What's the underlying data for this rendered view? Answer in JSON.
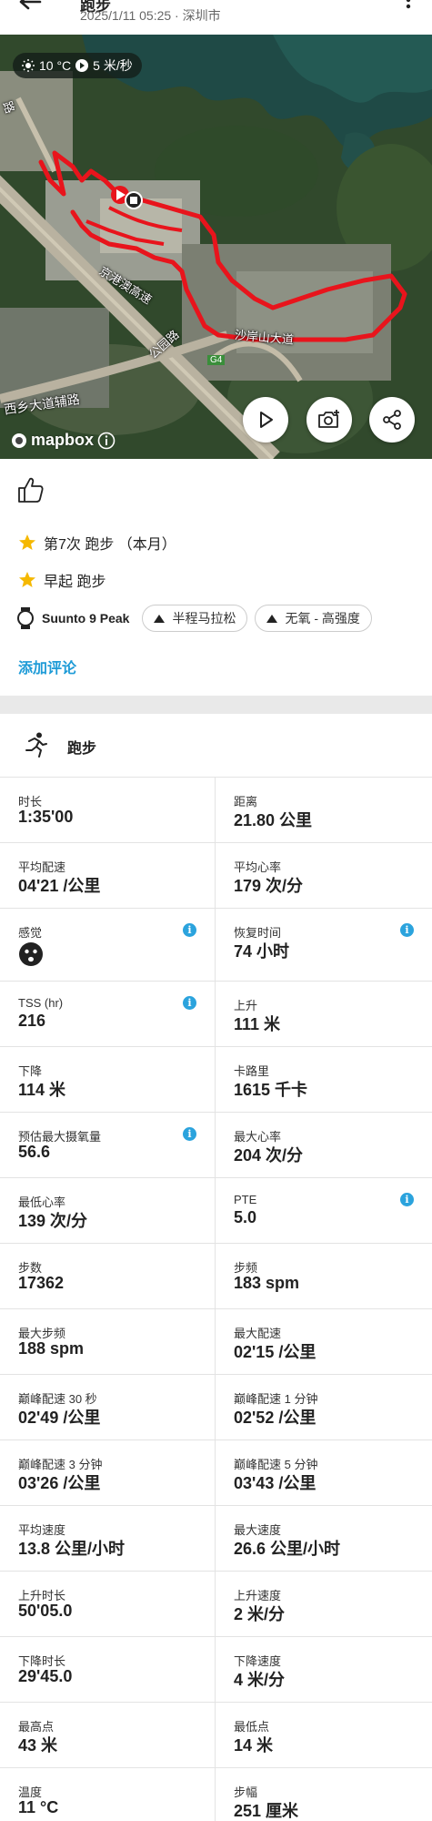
{
  "header": {
    "title": "跑步",
    "subtitle": "2025/1/11 05:25 · 深圳市"
  },
  "map": {
    "weather": {
      "temp": "10 °C",
      "wind": "5 米/秒"
    },
    "labels": [
      "京港澳高速",
      "公园路",
      "G4",
      "西乡大道辅路",
      "沙岸山大道",
      "路"
    ],
    "attribution": "mapbox"
  },
  "summary": {
    "achievements": [
      "第7次 跑步 （本月）",
      "早起 跑步"
    ],
    "device": "Suunto 9 Peak",
    "chips": [
      "半程马拉松",
      "无氧 - 高强度"
    ],
    "add_comment": "添加评论"
  },
  "activity": {
    "name": "跑步"
  },
  "stats": [
    {
      "label": "时长",
      "value": "1:35'00",
      "info": false
    },
    {
      "label": "距离",
      "value": "21.80 公里",
      "info": false
    },
    {
      "label": "平均配速",
      "value": "04'21 /公里",
      "info": false
    },
    {
      "label": "平均心率",
      "value": "179 次/分",
      "info": false
    },
    {
      "label": "感觉",
      "value": "",
      "info": true,
      "face": true
    },
    {
      "label": "恢复时间",
      "value": "74 小时",
      "info": true
    },
    {
      "label": "TSS (hr)",
      "value": "216",
      "info": true
    },
    {
      "label": "上升",
      "value": "111 米",
      "info": false
    },
    {
      "label": "下降",
      "value": "114 米",
      "info": false
    },
    {
      "label": "卡路里",
      "value": "1615 千卡",
      "info": false
    },
    {
      "label": "预估最大摄氧量",
      "value": "56.6",
      "info": true
    },
    {
      "label": "最大心率",
      "value": "204 次/分",
      "info": false
    },
    {
      "label": "最低心率",
      "value": "139 次/分",
      "info": false
    },
    {
      "label": "PTE",
      "value": "5.0",
      "info": true
    },
    {
      "label": "步数",
      "value": "17362",
      "info": false
    },
    {
      "label": "步频",
      "value": "183 spm",
      "info": false
    },
    {
      "label": "最大步频",
      "value": "188 spm",
      "info": false
    },
    {
      "label": "最大配速",
      "value": "02'15 /公里",
      "info": false
    },
    {
      "label": "巅峰配速 30 秒",
      "value": "02'49 /公里",
      "info": false
    },
    {
      "label": "巅峰配速 1 分钟",
      "value": "02'52 /公里",
      "info": false
    },
    {
      "label": "巅峰配速 3 分钟",
      "value": "03'26 /公里",
      "info": false
    },
    {
      "label": "巅峰配速 5 分钟",
      "value": "03'43 /公里",
      "info": false
    },
    {
      "label": "平均速度",
      "value": "13.8 公里/小时",
      "info": false
    },
    {
      "label": "最大速度",
      "value": "26.6 公里/小时",
      "info": false
    },
    {
      "label": "上升时长",
      "value": "50'05.0",
      "info": false
    },
    {
      "label": "上升速度",
      "value": "2 米/分",
      "info": false
    },
    {
      "label": "下降时长",
      "value": "29'45.0",
      "info": false
    },
    {
      "label": "下降速度",
      "value": "4 米/分",
      "info": false
    },
    {
      "label": "最高点",
      "value": "43 米",
      "info": false
    },
    {
      "label": "最低点",
      "value": "14 米",
      "info": false
    },
    {
      "label": "温度",
      "value": "11 °C",
      "info": false
    },
    {
      "label": "步幅",
      "value": "251 厘米",
      "info": false
    }
  ],
  "colors": {
    "accent": "#1e9bd7",
    "info": "#2ba3dd",
    "route": "#e8141c",
    "star": "#f5b800"
  }
}
